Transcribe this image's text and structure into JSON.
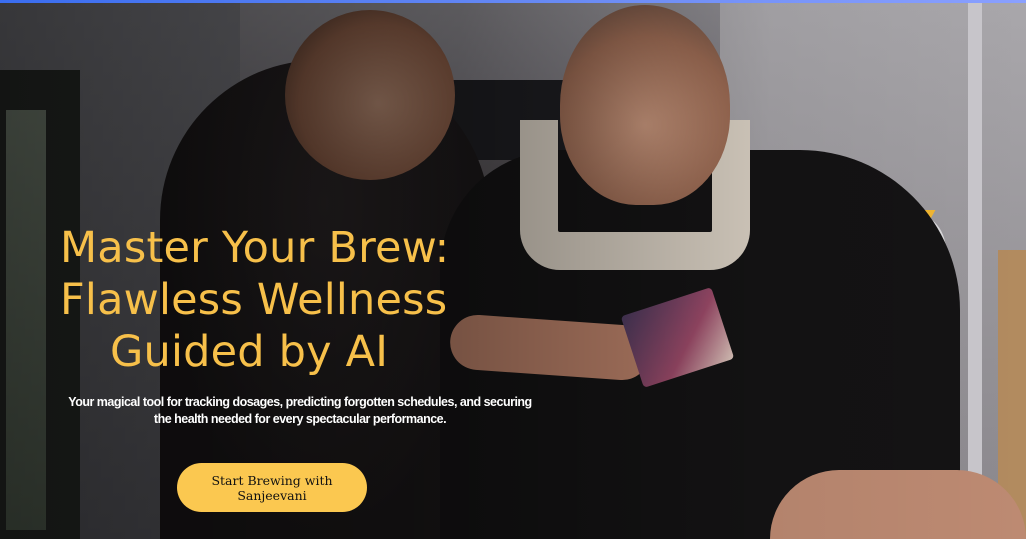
{
  "hero": {
    "headline": [
      "Master Your Brew:",
      "Flawless Wellness",
      "Guided by AI"
    ],
    "subtext_line1": "Your magical tool for tracking dosages, predicting forgotten schedules, and securing",
    "subtext_line2": "the health needed for every spectacular performance.",
    "cta_label": "Start Brewing with Sanjeevani"
  },
  "colors": {
    "headline": "#f7c04a",
    "cta_background": "#fbc850",
    "cta_text": "#111111",
    "top_accent": "#3a6df0"
  },
  "background_image": {
    "icon": "hero-photo-gym-trainer"
  }
}
